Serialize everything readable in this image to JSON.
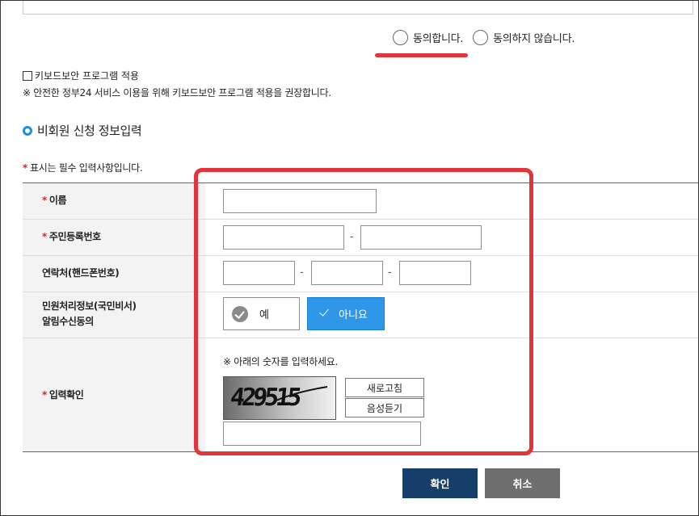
{
  "consent": {
    "agree_label": "동의합니다.",
    "disagree_label": "동의하지 않습니다."
  },
  "keyboard_security": {
    "checkbox_label": "키보드보안 프로그램 적용",
    "note": "※ 안전한 정부24 서비스 이용을 위해 키보드보안 프로그램 적용을 권장합니다."
  },
  "section": {
    "title": "비회원 신청 정보입력",
    "required_star": "*",
    "required_note": "표시는 필수 입력사항입니다."
  },
  "form": {
    "name_label": "이름",
    "rrn_label": "주민등록번호",
    "phone_label": "연락처(핸드폰번호)",
    "alarm_label_line1": "민원처리정보(국민비서)",
    "alarm_label_line2": "알림수신동의",
    "alarm_yes": "예",
    "alarm_no": "아니요",
    "alarm_selected": "아니요",
    "captcha_label": "입력확인",
    "captcha_note": "※ 아래의 숫자를 입력하세요.",
    "captcha_digits": "429515",
    "refresh_label": "새로고침",
    "audio_label": "음성듣기",
    "dash": "-"
  },
  "buttons": {
    "confirm": "확인",
    "cancel": "취소"
  },
  "colors": {
    "highlight_red": "#e3343c",
    "selected_blue": "#2e97e8",
    "confirm_navy": "#163e6b",
    "cancel_gray": "#6e6e6e",
    "section_ring": "#1d8fdc"
  }
}
